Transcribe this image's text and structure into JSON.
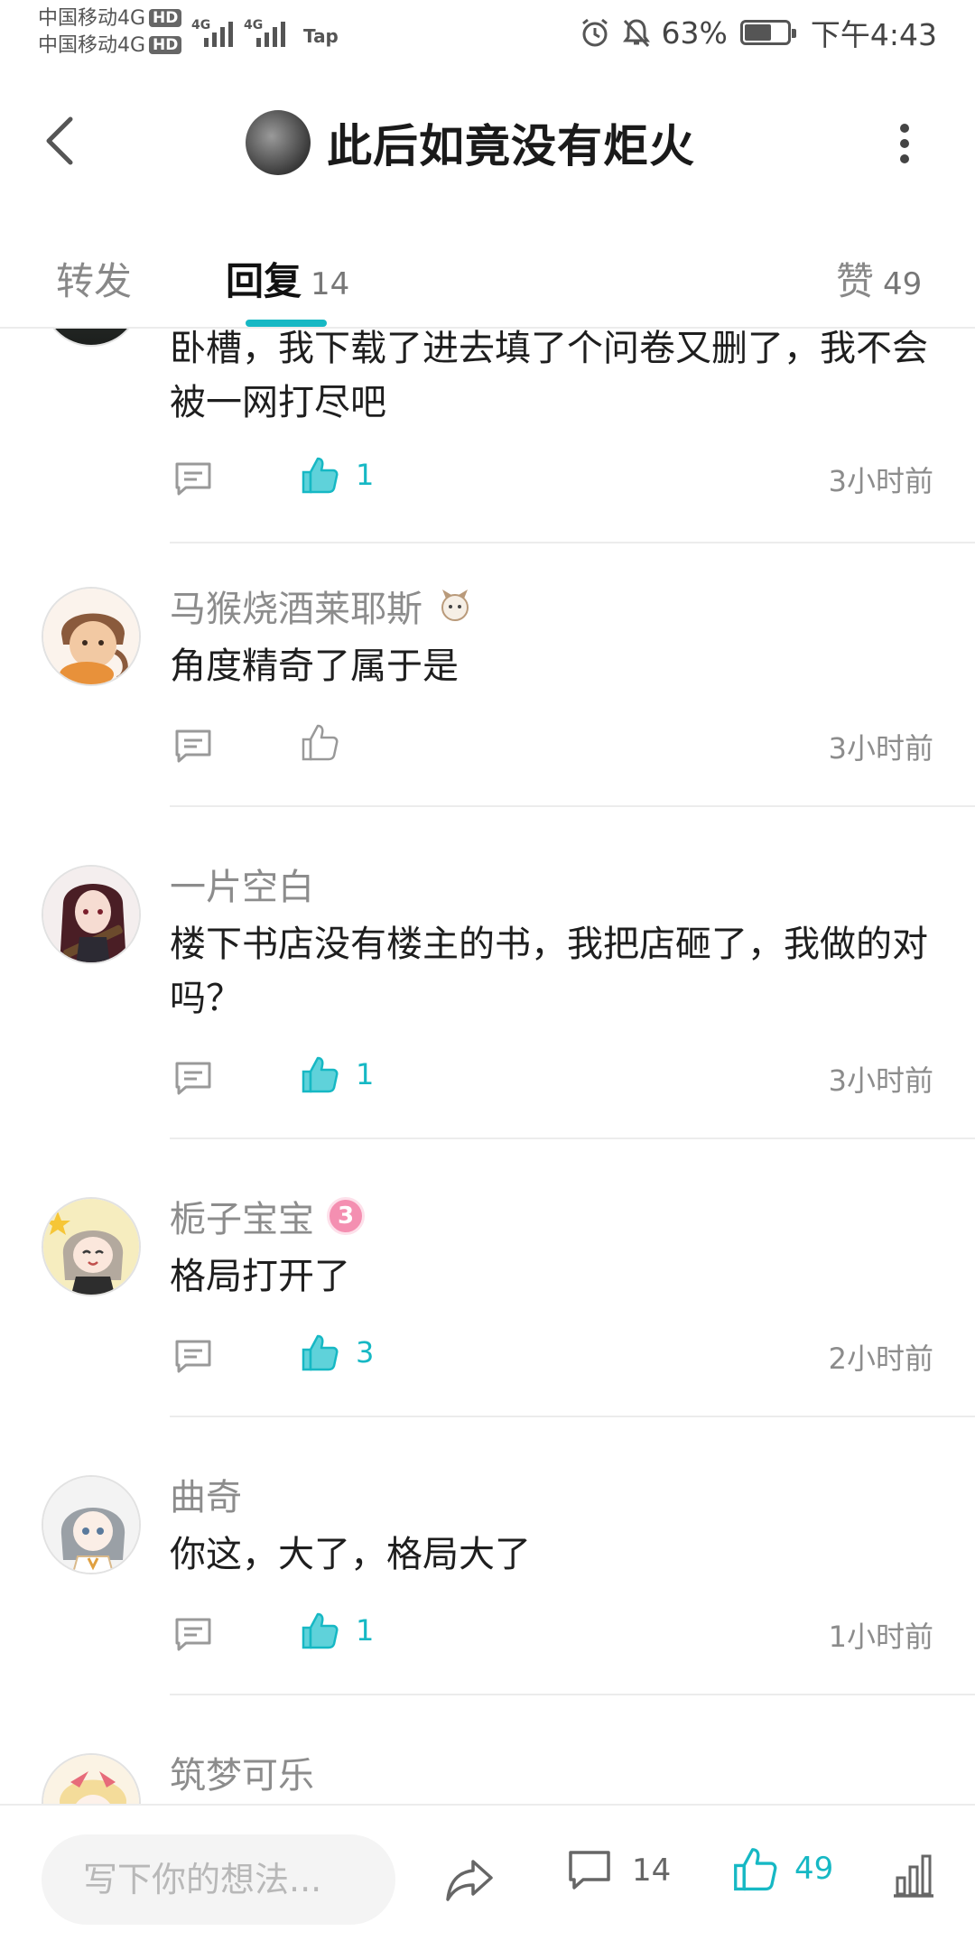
{
  "status_bar": {
    "carrier_1": "中国移动4G",
    "carrier_2": "中国移动4G",
    "hd_badge": "HD",
    "network_1": "4G",
    "network_2": "4G",
    "app_tag": "Tap",
    "battery_percent": "63%",
    "battery_level": 0.63,
    "time": "下午4:43",
    "icons": [
      "alarm-icon",
      "mute-icon",
      "battery-icon"
    ]
  },
  "header": {
    "title": "此后如竟没有炬火",
    "icons": [
      "back-icon",
      "more-icon"
    ]
  },
  "tabs": [
    {
      "label": "转发",
      "count": ""
    },
    {
      "label": "回复",
      "count": "14"
    },
    {
      "label": "赞",
      "count": "49"
    }
  ],
  "comments": [
    {
      "username": "",
      "content": "卧槽，我下载了进去填了个问卷又删了，我不会被一网打尽吧",
      "likes": "1",
      "liked": true,
      "time": "3小时前"
    },
    {
      "username": "马猴烧酒莱耶斯",
      "content": "角度精奇了属于是",
      "likes": "",
      "liked": false,
      "time": "3小时前"
    },
    {
      "username": "一片空白",
      "content": "楼下书店没有楼主的书，我把店砸了，我做的对吗？",
      "likes": "1",
      "liked": true,
      "time": "3小时前"
    },
    {
      "username": "栀子宝宝",
      "badge": "3",
      "content": "格局打开了",
      "likes": "3",
      "liked": true,
      "time": "2小时前"
    },
    {
      "username": "曲奇",
      "content": "你这，大了，格局大了",
      "likes": "1",
      "liked": true,
      "time": "1小时前"
    },
    {
      "username": "筑梦可乐",
      "content": "",
      "likes": "",
      "liked": false,
      "time": ""
    }
  ],
  "bottom_bar": {
    "input_placeholder": "写下你的想法...",
    "comment_count": "14",
    "like_count": "49",
    "accent_color": "#16b8c4"
  }
}
